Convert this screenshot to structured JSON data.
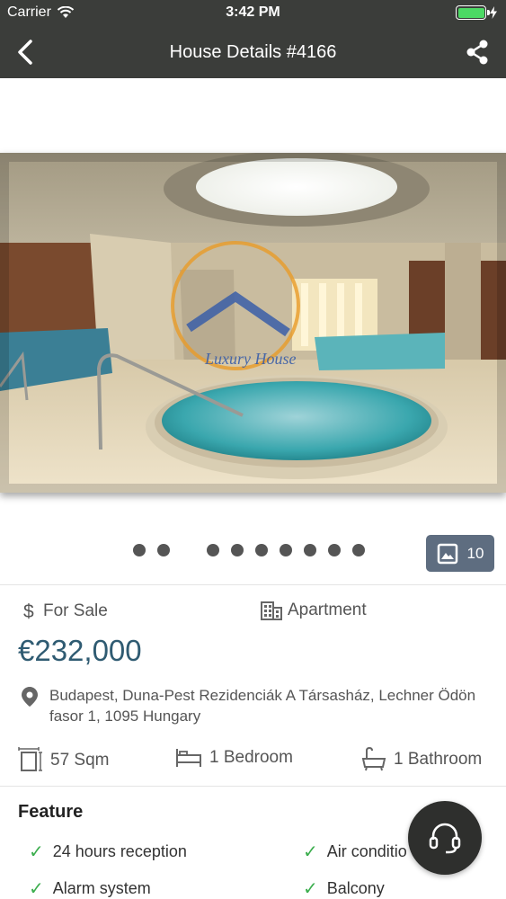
{
  "status_bar": {
    "carrier": "Carrier",
    "time": "3:42 PM",
    "battery_level": 1.0
  },
  "nav": {
    "title": "House Details #4166",
    "back_icon": "chevron-left-icon",
    "share_icon": "share-icon"
  },
  "gallery": {
    "watermark_text": "Luxury House",
    "dot_count": 9,
    "photo_count": "10"
  },
  "listing": {
    "status": "For Sale",
    "type": "Apartment",
    "price": "€232,000",
    "address": "Budapest, Duna-Pest Rezidenciák A Társasház, Lechner Ödön fasor 1, 1095 Hungary",
    "area": "57 Sqm",
    "bedrooms": "1 Bedroom",
    "bathrooms": "1 Bathroom"
  },
  "features": {
    "title": "Feature",
    "items": [
      "24 hours reception",
      "Air conditio",
      "Alarm system",
      "Balcony"
    ]
  },
  "colors": {
    "header": "#3b3d3a",
    "price": "#2f5b72",
    "badge": "#5e6d80",
    "check": "#3cae4e",
    "battery": "#4cd964"
  }
}
